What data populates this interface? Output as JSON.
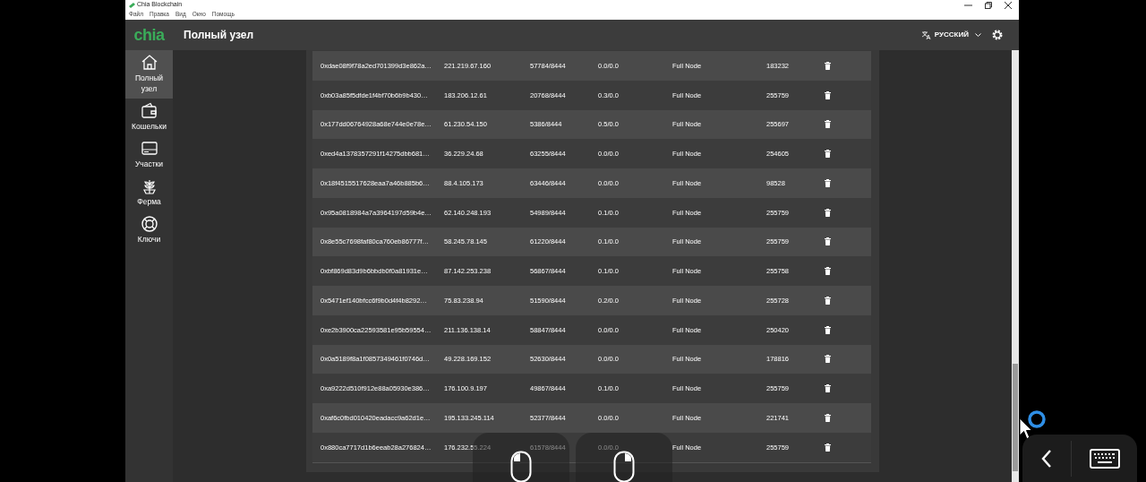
{
  "window": {
    "title": "Chia Blockchain"
  },
  "menu": [
    "Файл",
    "Правка",
    "Вид",
    "Окно",
    "Помощь"
  ],
  "header": {
    "logo": "chia",
    "title": "Полный узел",
    "language": "РУССКИЙ"
  },
  "sidebar": {
    "items": [
      {
        "label": "Полный узел",
        "kind": "home",
        "selected": true
      },
      {
        "label": "Кошельки",
        "kind": "wallet",
        "selected": false
      },
      {
        "label": "Участки",
        "kind": "drive",
        "selected": false
      },
      {
        "label": "Ферма",
        "kind": "plant",
        "selected": false
      },
      {
        "label": "Ключи",
        "kind": "lifebuoy",
        "selected": false
      }
    ]
  },
  "table": {
    "rows": [
      [
        "0xdae08f9f78a2ed701399d3e862a…",
        "221.219.67.160",
        "57784/8444",
        "0.0/0.0",
        "Full Node",
        "183232"
      ],
      [
        "0xb03a85f5dfde1f4bf70b6b9b430…",
        "183.206.12.61",
        "20768/8444",
        "0.3/0.0",
        "Full Node",
        "255759"
      ],
      [
        "0x177dd06764928a68e744e0e78e…",
        "61.230.54.150",
        "5386/8444",
        "0.5/0.0",
        "Full Node",
        "255697"
      ],
      [
        "0xed4a1378357291f14275dbb681…",
        "36.229.24.68",
        "63255/8444",
        "0.0/0.0",
        "Full Node",
        "254605"
      ],
      [
        "0x18f4515517628eaa7a46b885b6…",
        "88.4.105.173",
        "63446/8444",
        "0.0/0.0",
        "Full Node",
        "98528"
      ],
      [
        "0x95a0818984a7a3964197d59b4e…",
        "62.140.248.193",
        "54989/8444",
        "0.1/0.0",
        "Full Node",
        "255759"
      ],
      [
        "0x8e55c7698faf80ca760eb86777f…",
        "58.245.78.145",
        "61220/8444",
        "0.1/0.0",
        "Full Node",
        "255759"
      ],
      [
        "0xbf869d83d9b6bbdb0f0a81931e…",
        "87.142.253.238",
        "56867/8444",
        "0.1/0.0",
        "Full Node",
        "255758"
      ],
      [
        "0x5471ef140bfcc6f9b0d4f4b8292…",
        "75.83.238.94",
        "51590/8444",
        "0.2/0.0",
        "Full Node",
        "255728"
      ],
      [
        "0xe2b3900ca22593581e95b59554…",
        "211.136.138.14",
        "58847/8444",
        "0.0/0.0",
        "Full Node",
        "250420"
      ],
      [
        "0x0a5189f8a1f0857349461f0746d…",
        "49.228.169.152",
        "52630/8444",
        "0.0/0.0",
        "Full Node",
        "178816"
      ],
      [
        "0xa9222d510f912e88a05930e386…",
        "176.100.9.197",
        "49867/8444",
        "0.1/0.0",
        "Full Node",
        "255759"
      ],
      [
        "0xaf6c0fbd010420eadacc9a62d1e…",
        "195.133.245.114",
        "52377/8444",
        "0.0/0.0",
        "Full Node",
        "221741"
      ],
      [
        "0x880ca7717d1b6eeab28a276824…",
        "176.232.55.224",
        "61578/8444",
        "0.0/0.0",
        "Full Node",
        "255759"
      ]
    ]
  }
}
